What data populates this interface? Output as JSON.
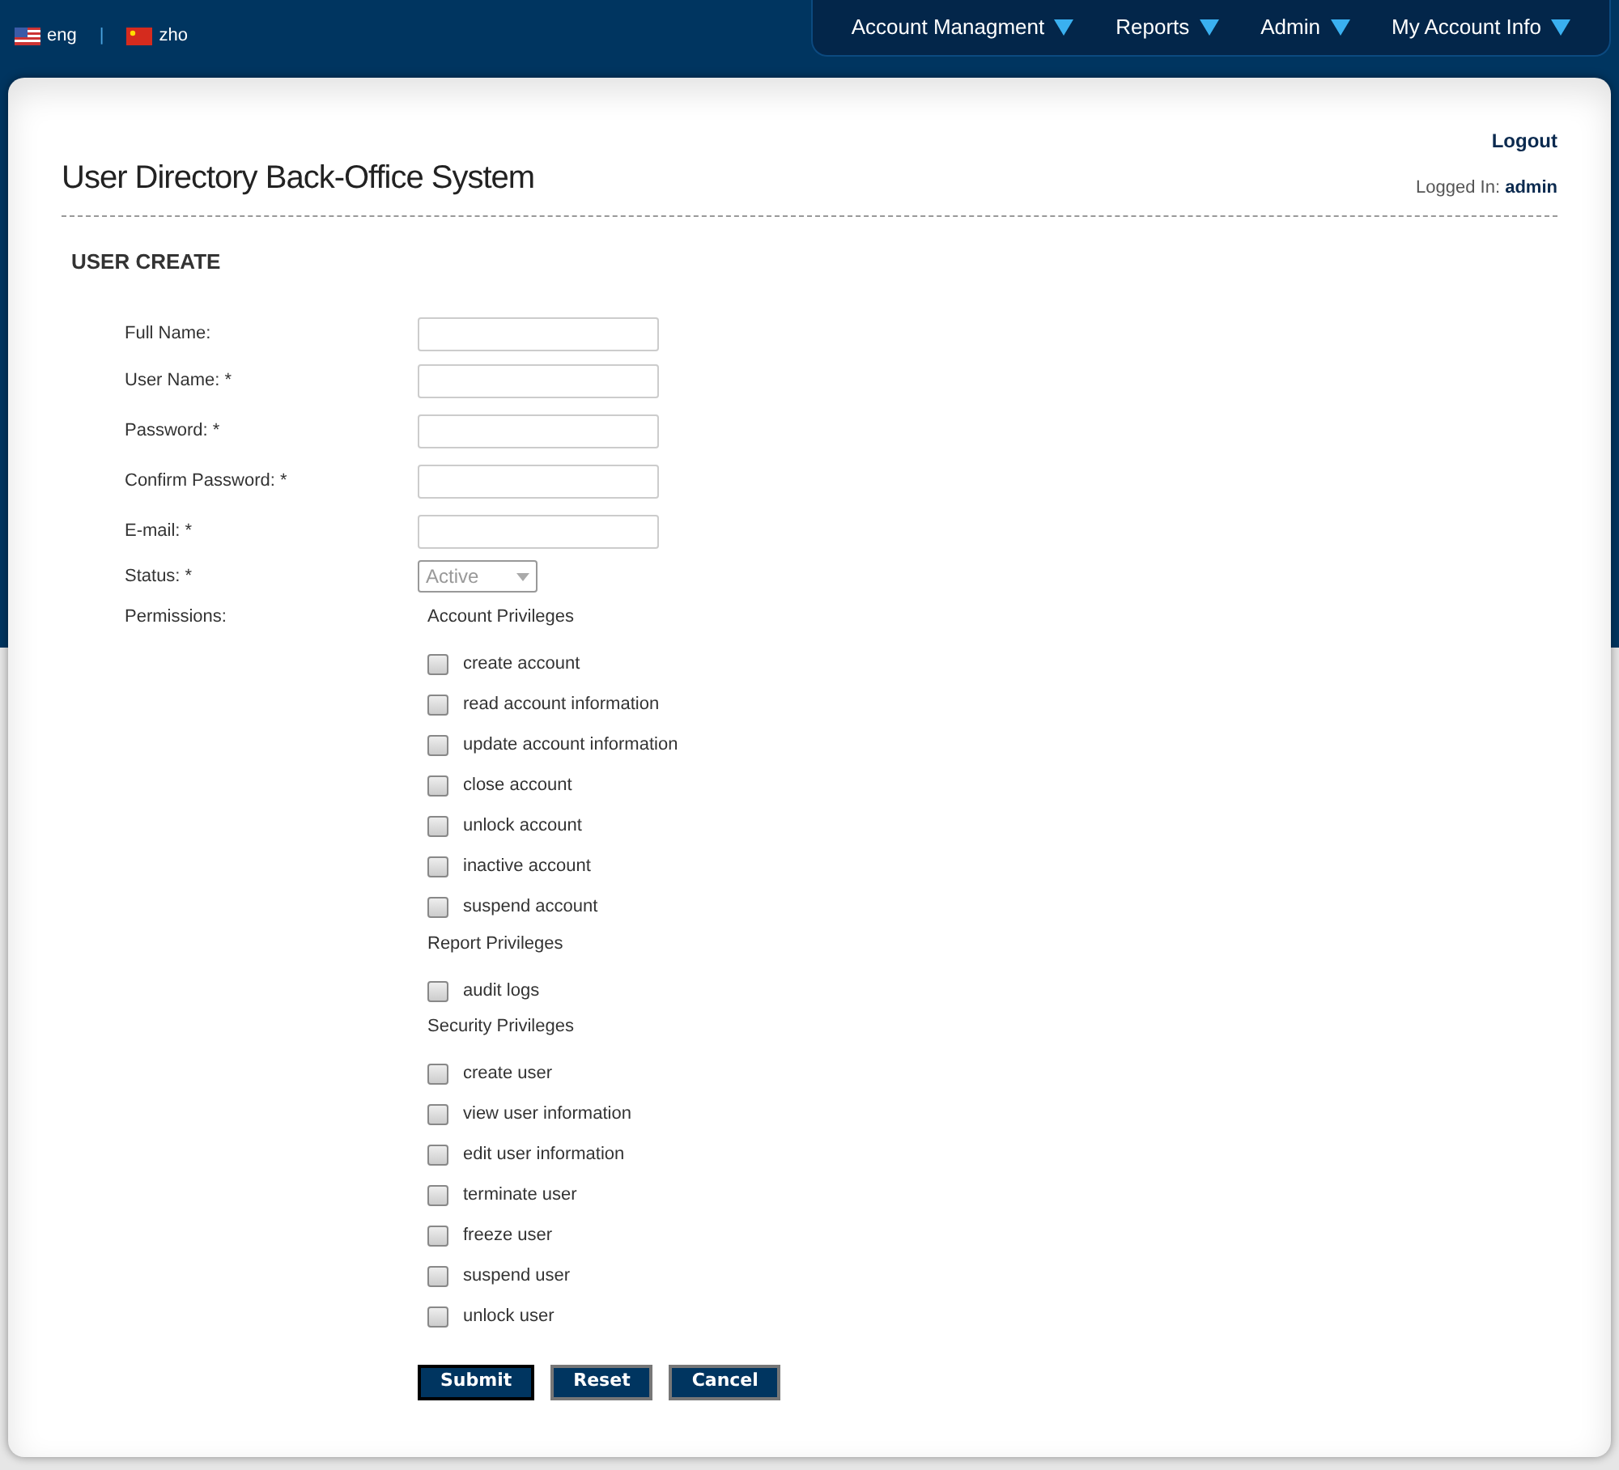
{
  "languages": [
    {
      "label": "eng",
      "kind": "us"
    },
    {
      "label": "zho",
      "kind": "cn"
    }
  ],
  "language_separator": "|",
  "nav": [
    {
      "label": "Account Managment"
    },
    {
      "label": "Reports"
    },
    {
      "label": "Admin"
    },
    {
      "label": "My Account Info"
    }
  ],
  "header": {
    "title": "User Directory Back-Office System",
    "logout": "Logout",
    "logged_in_label": "Logged In:",
    "logged_in_user": "admin"
  },
  "section_title": "USER CREATE",
  "fields": [
    {
      "label": "Full Name:",
      "kind": "text"
    },
    {
      "label": "User Name: *",
      "kind": "text"
    },
    {
      "label": "Password: *",
      "kind": "text"
    },
    {
      "label": "Confirm Password: *",
      "kind": "text"
    },
    {
      "label": "E-mail: *",
      "kind": "text"
    },
    {
      "label": "Status: *",
      "kind": "select",
      "value": "Active"
    }
  ],
  "permissions": {
    "label": "Permissions:",
    "groups": [
      {
        "title": "Account Privileges",
        "items": [
          {
            "label": "create account",
            "checked": false
          },
          {
            "label": "read account information",
            "checked": false
          },
          {
            "label": "update account information",
            "checked": false
          },
          {
            "label": "close account",
            "checked": false
          },
          {
            "label": "unlock account",
            "checked": false
          },
          {
            "label": "inactive account",
            "checked": false
          },
          {
            "label": "suspend account",
            "checked": false
          }
        ]
      },
      {
        "title": "Report Privileges",
        "items": [
          {
            "label": "audit logs",
            "checked": false
          }
        ]
      },
      {
        "title": "Security Privileges",
        "items": [
          {
            "label": "create user",
            "checked": false
          },
          {
            "label": "view user information",
            "checked": false
          },
          {
            "label": "edit user information",
            "checked": false
          },
          {
            "label": "terminate user",
            "checked": false
          },
          {
            "label": "freeze user",
            "checked": false
          },
          {
            "label": "suspend user",
            "checked": false
          },
          {
            "label": "unlock user",
            "checked": false
          }
        ]
      }
    ]
  },
  "buttons": [
    {
      "label": "Submit",
      "focused": true
    },
    {
      "label": "Reset",
      "focused": false
    },
    {
      "label": "Cancel",
      "focused": false
    }
  ]
}
